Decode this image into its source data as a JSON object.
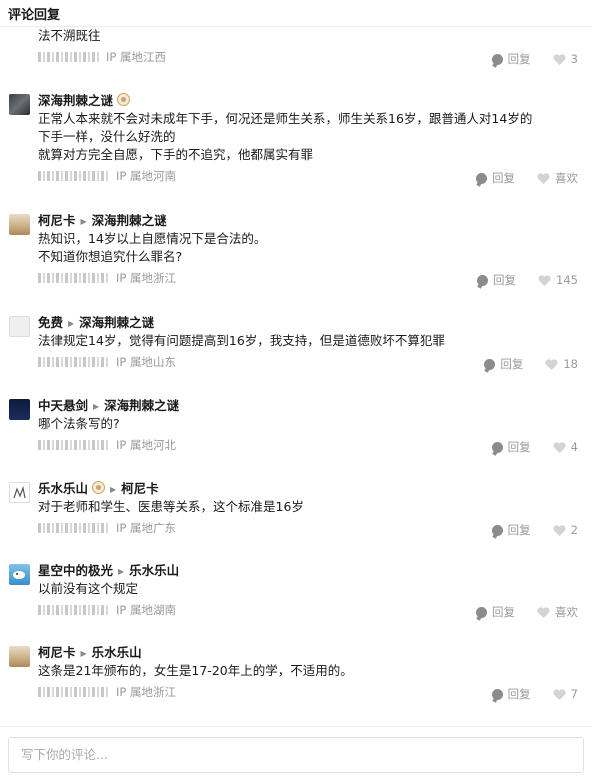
{
  "header": {
    "title": "评论回复"
  },
  "actions": {
    "reply_label": "回复",
    "like_label_empty": "喜欢"
  },
  "comments": [
    {
      "author": "",
      "reply_to": "",
      "badge": false,
      "lines": [
        "法不溯既往"
      ],
      "ip": "IP 属地江西",
      "likes": "3"
    },
    {
      "author": "深海荆棘之谜",
      "reply_to": "",
      "badge": true,
      "lines": [
        "正常人本来就不会对未成年下手，何况还是师生关系，师生关系16岁，跟普通人对14岁的",
        "下手一样，没什么好洗的",
        "就算对方完全自愿，下手的不追究，他都属实有罪"
      ],
      "ip": "IP 属地河南",
      "likes": "喜欢"
    },
    {
      "author": "柯尼卡",
      "reply_to": "深海荆棘之谜",
      "badge": false,
      "lines": [
        "热知识，14岁以上自愿情况下是合法的。",
        "不知道你想追究什么罪名?"
      ],
      "ip": "IP 属地浙江",
      "likes": "145"
    },
    {
      "author": "免费",
      "reply_to": "深海荆棘之谜",
      "badge": false,
      "lines": [
        "法律规定14岁，觉得有问题提高到16岁，我支持，但是道德败坏不算犯罪"
      ],
      "ip": "IP 属地山东",
      "likes": "18"
    },
    {
      "author": "中天悬剑",
      "reply_to": "深海荆棘之谜",
      "badge": false,
      "lines": [
        "哪个法条写的?"
      ],
      "ip": "IP 属地河北",
      "likes": "4"
    },
    {
      "author": "乐水乐山",
      "reply_to": "柯尼卡",
      "badge": true,
      "lines": [
        "对于老师和学生、医患等关系，这个标准是16岁"
      ],
      "ip": "IP 属地广东",
      "likes": "2"
    },
    {
      "author": "星空中的极光",
      "reply_to": "乐水乐山",
      "badge": false,
      "lines": [
        "以前没有这个规定"
      ],
      "ip": "IP 属地湖南",
      "likes": "喜欢"
    },
    {
      "author": "柯尼卡",
      "reply_to": "乐水乐山",
      "badge": false,
      "lines": [
        "这条是21年颁布的，女生是17-20年上的学，不适用的。"
      ],
      "ip": "IP 属地浙江",
      "likes": "7"
    }
  ],
  "composer": {
    "placeholder": "写下你的评论..."
  },
  "colors": {
    "icon_gray": "#8c8c8c",
    "meta_text": "#9a9a9a",
    "divider": "#ececec"
  }
}
